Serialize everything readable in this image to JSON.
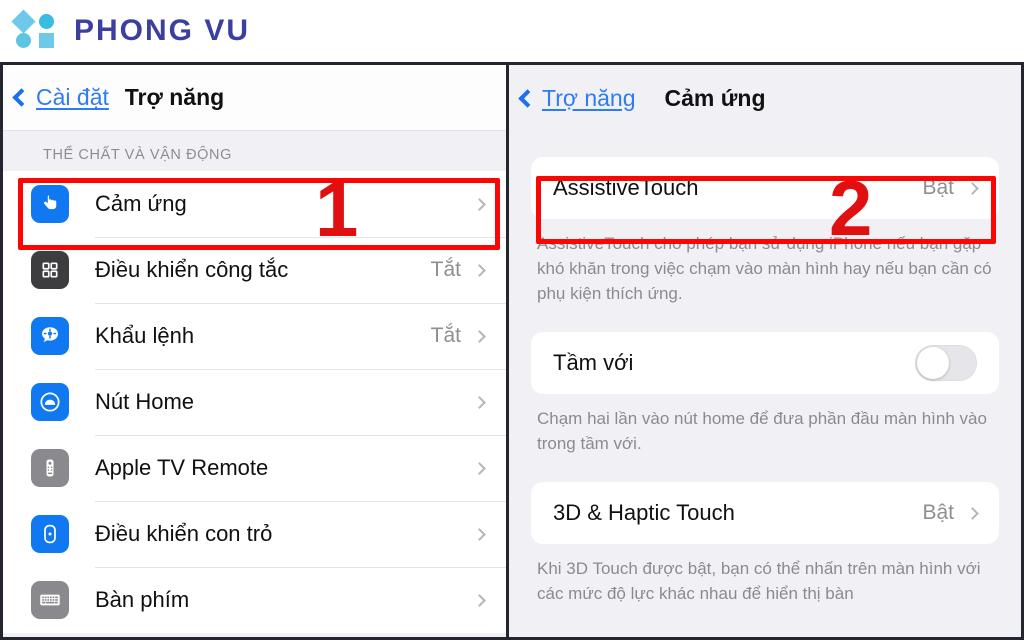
{
  "brand": {
    "name": "PHONG VU",
    "logo_colors": {
      "shapes": "#6ec9e8",
      "wordmark": "#3b3f9e"
    }
  },
  "annotations": {
    "step1": "1",
    "step2": "2",
    "highlight_color": "#fc0505"
  },
  "left_panel": {
    "back_label": "Cài đặt",
    "title": "Trợ năng",
    "section_header": "THỂ CHẤT VÀ VẬN ĐỘNG",
    "rows": [
      {
        "label": "Cảm ứng",
        "value": "",
        "icon": "touch-hand-icon"
      },
      {
        "label": "Điều khiển công tắc",
        "value": "Tắt",
        "icon": "switch-grid-icon"
      },
      {
        "label": "Khẩu lệnh",
        "value": "Tắt",
        "icon": "voice-control-icon"
      },
      {
        "label": "Nút Home",
        "value": "",
        "icon": "home-button-icon"
      },
      {
        "label": "Apple TV Remote",
        "value": "",
        "icon": "apple-tv-remote-icon"
      },
      {
        "label": "Điều khiển con trỏ",
        "value": "",
        "icon": "pointer-control-icon"
      },
      {
        "label": "Bàn phím",
        "value": "",
        "icon": "keyboard-icon"
      }
    ]
  },
  "right_panel": {
    "back_label": "Trợ năng",
    "title": "Cảm ứng",
    "assistive_touch": {
      "label": "AssistiveTouch",
      "value": "Bật"
    },
    "assistive_touch_footnote": "AssistiveTouch cho phép bạn sử dụng iPhone nếu bạn gặp khó khăn trong việc chạm vào màn hình hay nếu bạn cần có phụ kiện thích ứng.",
    "reachability": {
      "label": "Tầm với",
      "toggle_state": "off"
    },
    "reachability_footnote": "Chạm hai lần vào nút home để đưa phần đầu màn hình vào trong tầm với.",
    "haptic": {
      "label": "3D & Haptic Touch",
      "value": "Bật"
    },
    "haptic_footnote": "Khi 3D Touch được bật, bạn có thể nhấn trên màn hình với các mức độ lực khác nhau để hiển thị bàn"
  }
}
